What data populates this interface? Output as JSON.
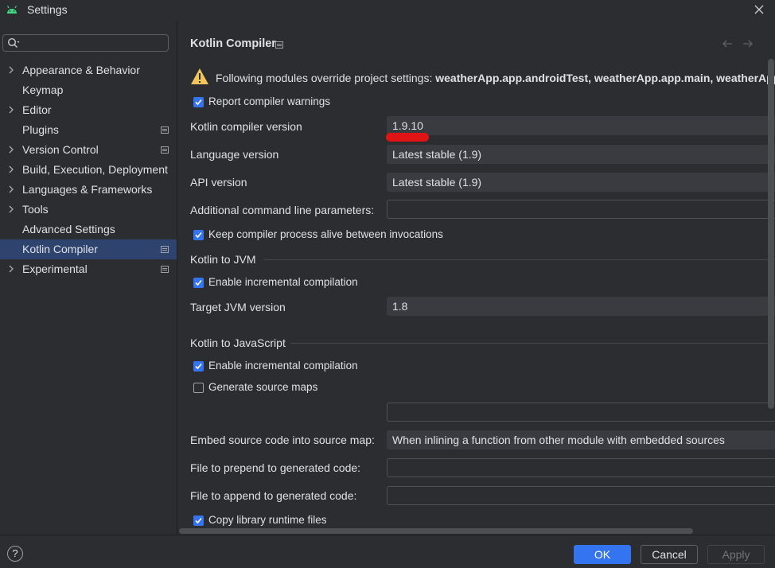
{
  "window": {
    "title": "Settings"
  },
  "sidebar": {
    "search": {
      "value": "",
      "placeholder": ""
    },
    "items": [
      {
        "label": "Appearance & Behavior",
        "expandable": true,
        "project": false
      },
      {
        "label": "Keymap",
        "expandable": false,
        "project": false
      },
      {
        "label": "Editor",
        "expandable": true,
        "project": false
      },
      {
        "label": "Plugins",
        "expandable": false,
        "project": true
      },
      {
        "label": "Version Control",
        "expandable": true,
        "project": true
      },
      {
        "label": "Build, Execution, Deployment",
        "expandable": true,
        "project": false
      },
      {
        "label": "Languages & Frameworks",
        "expandable": true,
        "project": false
      },
      {
        "label": "Tools",
        "expandable": true,
        "project": false
      },
      {
        "label": "Advanced Settings",
        "expandable": false,
        "project": false
      },
      {
        "label": "Kotlin Compiler",
        "expandable": false,
        "project": true,
        "selected": true
      },
      {
        "label": "Experimental",
        "expandable": true,
        "project": true
      }
    ]
  },
  "header": {
    "title": "Kotlin Compiler"
  },
  "warning": {
    "prefix": "Following modules override project settings: ",
    "modules": "weatherApp.app.androidTest, weatherApp.app.main, weatherApp.a"
  },
  "general": {
    "report_warnings": {
      "label": "Report compiler warnings",
      "checked": true
    },
    "compiler_version": {
      "label": "Kotlin compiler version",
      "value": "1.9.10"
    },
    "language_version": {
      "label": "Language version",
      "value": "Latest stable (1.9)"
    },
    "api_version": {
      "label": "API version",
      "value": "Latest stable (1.9)"
    },
    "cmd_params": {
      "label": "Additional command line parameters:",
      "value": ""
    },
    "keep_alive": {
      "label": "Keep compiler process alive between invocations",
      "checked": true
    }
  },
  "jvm": {
    "section": "Kotlin to JVM",
    "incremental": {
      "label": "Enable incremental compilation",
      "checked": true
    },
    "target": {
      "label": "Target JVM version",
      "value": "1.8"
    }
  },
  "js": {
    "section": "Kotlin to JavaScript",
    "incremental": {
      "label": "Enable incremental compilation",
      "checked": true
    },
    "source_maps": {
      "label": "Generate source maps",
      "checked": false
    },
    "source_map_prefix": {
      "value": ""
    },
    "embed_source": {
      "label": "Embed source code into source map:",
      "value": "When inlining a function from other module with embedded sources"
    },
    "prepend": {
      "label": "File to prepend to generated code:",
      "value": ""
    },
    "append": {
      "label": "File to append to generated code:",
      "value": ""
    },
    "copy_runtime": {
      "label": "Copy library runtime files",
      "checked": true
    }
  },
  "footer": {
    "help": "?",
    "ok": "OK",
    "cancel": "Cancel",
    "apply": "Apply"
  },
  "colors": {
    "accent": "#3574f0",
    "selection": "#2e436e",
    "background": "#2b2d30",
    "warning": "#f2c55c",
    "annotation": "#e01414"
  }
}
